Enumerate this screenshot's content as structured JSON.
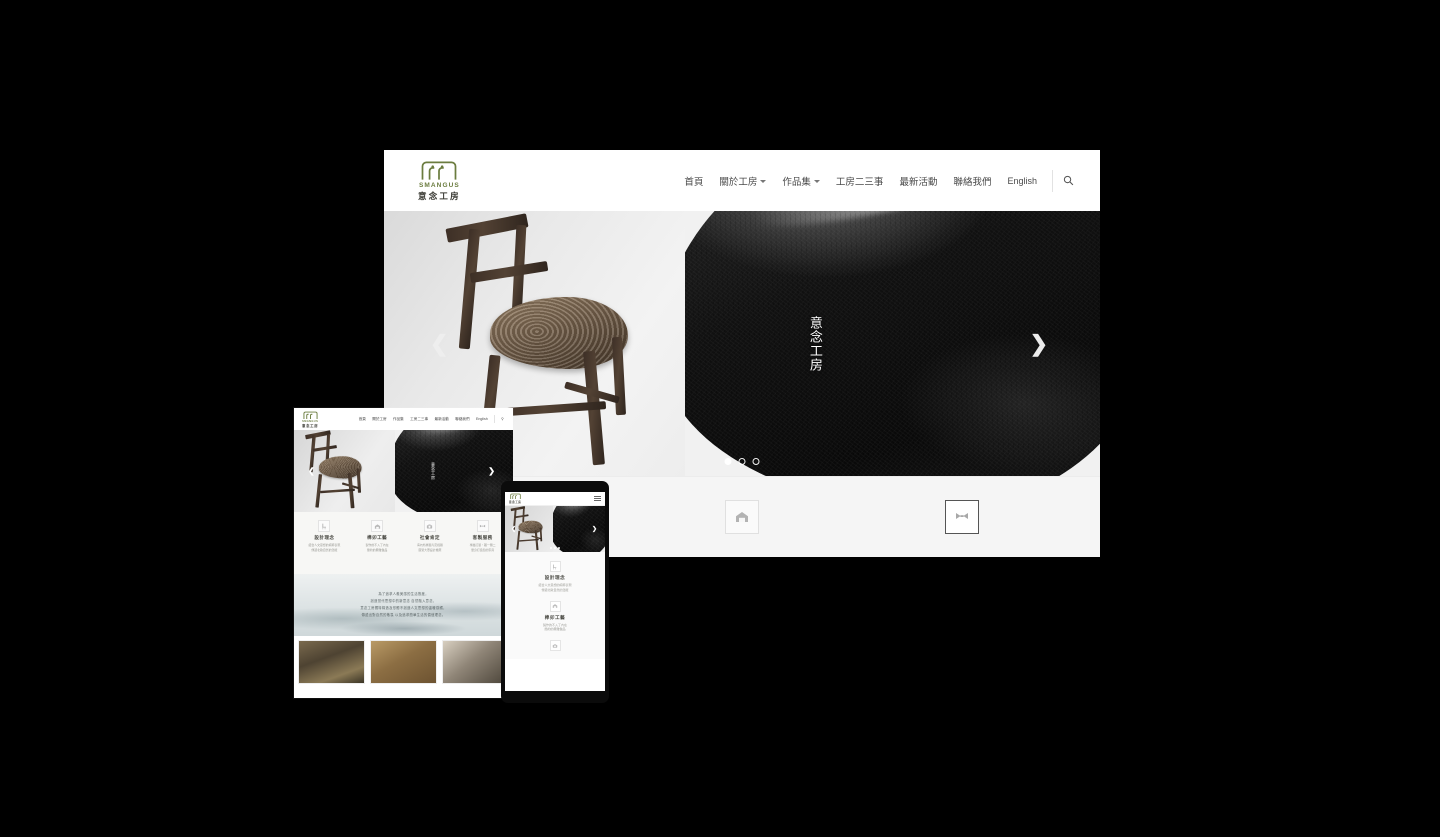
{
  "site": {
    "brand_en": "SMANGUS",
    "brand_cn": "意念工房",
    "logo_icon": "two-faces-logo-icon",
    "accent_color": "#6b7c3f",
    "text_color": "#4a4a4a"
  },
  "nav": {
    "items": [
      {
        "label": "首頁",
        "dropdown": false
      },
      {
        "label": "關於工房",
        "dropdown": true
      },
      {
        "label": "作品集",
        "dropdown": true
      },
      {
        "label": "工房二三事",
        "dropdown": false
      },
      {
        "label": "最新活動",
        "dropdown": false
      },
      {
        "label": "聯絡我們",
        "dropdown": false
      },
      {
        "label": "English",
        "dropdown": false
      }
    ],
    "search_icon": "search-icon"
  },
  "hero": {
    "vertical_title": "意念工房",
    "prev_icon": "chevron-left-icon",
    "next_icon": "chevron-right-icon",
    "slide_count": 3,
    "active_slide": 1,
    "left_image_alt": "wooden-chair",
    "right_image_alt": "ink-stone-texture"
  },
  "features": {
    "items": [
      {
        "title": "設計理念",
        "desc_line1": "結合人文思想的純粹表現",
        "desc_line2": "傳遞北歐自然的溫暖",
        "icon": "chair-icon"
      },
      {
        "title": "榫卯工藝",
        "desc_line1": "製作的不入丁內在",
        "desc_line2": "簡約的典雅做品",
        "icon": "workshop-icon"
      },
      {
        "title": "社會肯定",
        "desc_line1": "海內外屢獲肯定媒體",
        "desc_line2": "廣受大眾設計推薦",
        "icon": "camera-icon"
      },
      {
        "title": "客製服務",
        "desc_line1": "專屬訂製・獨一無二",
        "desc_line2": "量身打造您的家具",
        "icon": "joint-icon"
      }
    ]
  },
  "desktop_icon_row": {
    "items": [
      {
        "icon": "chair-icon",
        "selected": false
      },
      {
        "icon": "workshop-icon",
        "selected": false
      },
      {
        "icon": "joint-icon",
        "selected": true
      }
    ]
  },
  "quote": {
    "lines": [
      "為了追求人義美感的生活態度，",
      "創造當代思想中的新意念 自然融入意念，",
      "意念工房獨特構造及形體不創造人文思想的溫暖感觸，",
      "傳遞出對自然的敬畏 以及追求簡單生活的價值理念。"
    ]
  },
  "gallery": {
    "items": [
      {
        "alt": "workshop-bench-photo"
      },
      {
        "alt": "wooden-cabinet-photo"
      },
      {
        "alt": "carved-stool-photo"
      }
    ]
  },
  "phone": {
    "menu_icon": "hamburger-menu-icon",
    "prev_icon": "chevron-left-icon",
    "next_icon": "chevron-right-icon"
  }
}
